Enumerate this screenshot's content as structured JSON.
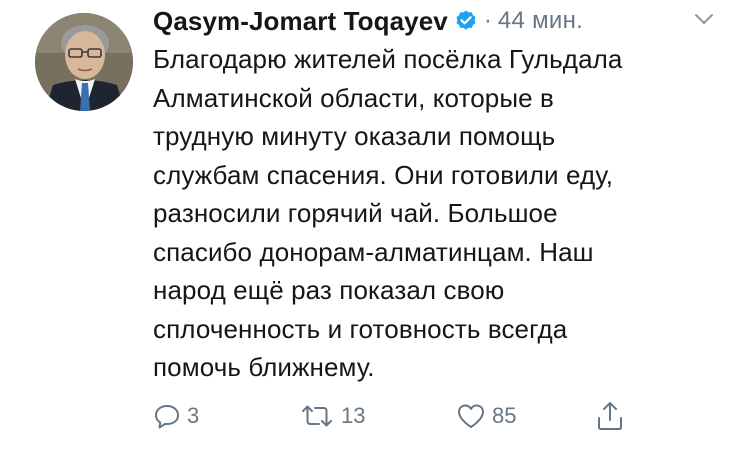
{
  "tweet": {
    "author": {
      "display_name": "Qasym-Jomart Toqayev",
      "verified": true,
      "avatar_icon": "user-avatar-photo"
    },
    "separator": "·",
    "time": "44 мин.",
    "text": "Благодарю жителей посёлка Гульдала\nАлматинской области, которые  в\nтрудную минуту оказали помощь\nслужбам спасения. Они готовили еду,\nразносили горячий чай. Большое\nспасибо донорам-алматинцам. Наш\nнарод ещё раз показал свою\nсплоченность и готовность всегда\nпомочь ближнему.",
    "actions": {
      "reply_count": "3",
      "retweet_count": "13",
      "like_count": "85"
    },
    "colors": {
      "text": "#14171a",
      "secondary": "#657786",
      "verified": "#1da1f2"
    },
    "icons": [
      "verified-badge-icon",
      "chevron-down-icon",
      "reply-icon",
      "retweet-icon",
      "like-icon",
      "share-icon"
    ]
  }
}
